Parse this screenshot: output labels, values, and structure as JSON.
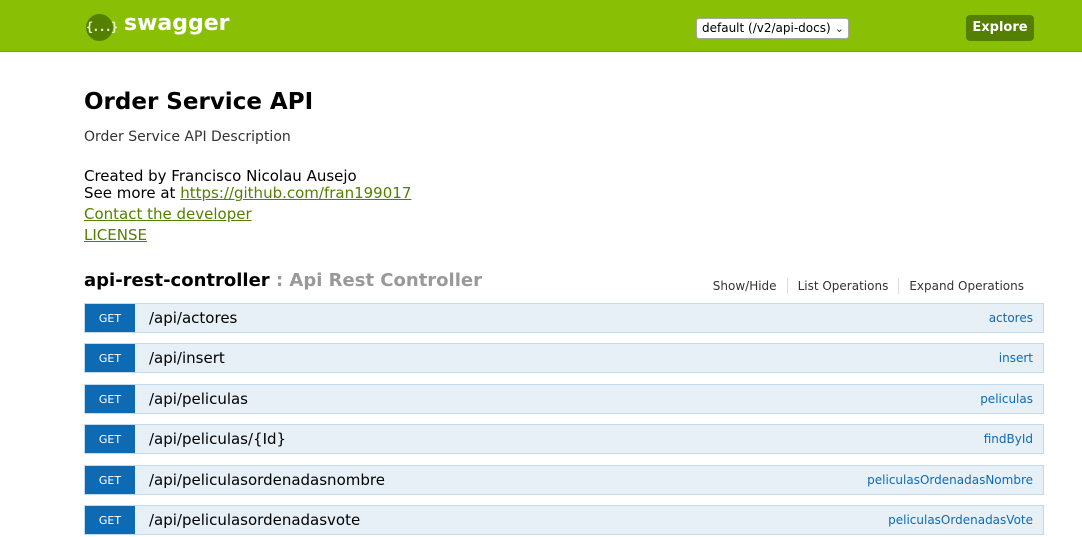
{
  "header": {
    "logo_icon": "{...}",
    "logo_text": "swagger",
    "spec_select": {
      "selected": "default (/v2/api-docs)"
    },
    "explore_label": "Explore",
    "colors": {
      "bar": "#89bf04",
      "dark": "#547f00"
    }
  },
  "info": {
    "title": "Order Service API",
    "description": "Order Service API Description",
    "created_by": "Created by Francisco Nicolau Ausejo",
    "see_more_prefix": "See more at ",
    "see_more_link": "https://github.com/fran199017",
    "contact_label": "Contact the developer",
    "license_label": "LICENSE"
  },
  "resource": {
    "name": "api-rest-controller",
    "separator_desc": " : Api Rest Controller",
    "actions": [
      "Show/Hide",
      "List Operations",
      "Expand Operations"
    ]
  },
  "operations": [
    {
      "method": "GET",
      "path": "/api/actores",
      "nickname": "actores"
    },
    {
      "method": "GET",
      "path": "/api/insert",
      "nickname": "insert"
    },
    {
      "method": "GET",
      "path": "/api/peliculas",
      "nickname": "peliculas"
    },
    {
      "method": "GET",
      "path": "/api/peliculas/{Id}",
      "nickname": "findById"
    },
    {
      "method": "GET",
      "path": "/api/peliculasordenadasnombre",
      "nickname": "peliculasOrdenadasNombre"
    },
    {
      "method": "GET",
      "path": "/api/peliculasordenadasvote",
      "nickname": "peliculasOrdenadasVote"
    }
  ],
  "colors": {
    "get_method": "#0f6ab4",
    "get_row_bg": "#e7f0f7",
    "link": "#547f00"
  }
}
